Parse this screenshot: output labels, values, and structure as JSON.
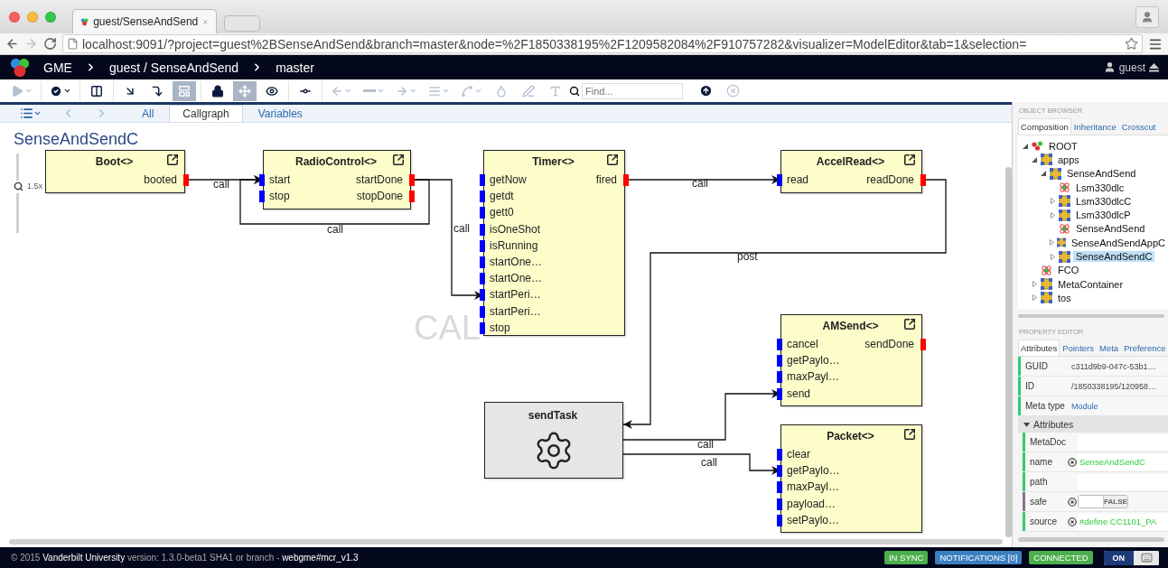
{
  "browser": {
    "tab_title": "guest/SenseAndSend",
    "url": "localhost:9091/?project=guest%2BSenseAndSend&branch=master&node=%2F1850338195%2F1209582084%2F910757282&visualizer=ModelEditor&tab=1&selection=",
    "nav": [
      {
        "kind": "back",
        "disabled": false
      },
      {
        "kind": "forward",
        "disabled": true
      },
      {
        "kind": "reload",
        "disabled": false
      }
    ]
  },
  "header": {
    "app": "GME",
    "project": "guest / SenseAndSend",
    "branch": "master",
    "user": "guest"
  },
  "toolbar": {
    "buttons": [
      {
        "kind": "play",
        "pressed": false,
        "disabled": true,
        "dropdown": true
      },
      {
        "kind": "check",
        "pressed": false,
        "disabled": false,
        "dropdown": true
      },
      {
        "kind": "split",
        "pressed": false,
        "disabled": false,
        "dropdown": false
      },
      {
        "kind": "arrow",
        "pressed": false,
        "disabled": false,
        "dropdown": false
      },
      {
        "kind": "elbow",
        "pressed": false,
        "disabled": false,
        "dropdown": false
      },
      {
        "kind": "grid",
        "pressed": true,
        "disabled": false,
        "dropdown": false
      },
      {
        "kind": "lock",
        "pressed": false,
        "disabled": false,
        "dropdown": false
      },
      {
        "kind": "move",
        "pressed": true,
        "disabled": false,
        "dropdown": false
      },
      {
        "kind": "eye",
        "pressed": false,
        "disabled": false,
        "dropdown": false
      },
      {
        "kind": "connector",
        "pressed": false,
        "disabled": false,
        "dropdown": false
      },
      {
        "kind": "left",
        "pressed": false,
        "disabled": true,
        "dropdown": true
      },
      {
        "kind": "line",
        "pressed": false,
        "disabled": true,
        "dropdown": true
      },
      {
        "kind": "right",
        "pressed": false,
        "disabled": true,
        "dropdown": true
      },
      {
        "kind": "lines",
        "pressed": false,
        "disabled": true,
        "dropdown": true
      },
      {
        "kind": "curve",
        "pressed": false,
        "disabled": true,
        "dropdown": true
      },
      {
        "kind": "fill",
        "pressed": false,
        "disabled": true,
        "dropdown": false
      },
      {
        "kind": "pen",
        "pressed": false,
        "disabled": true,
        "dropdown": false
      },
      {
        "kind": "text",
        "pressed": false,
        "disabled": true,
        "dropdown": false
      }
    ],
    "search": {
      "placeholder": "Find..."
    },
    "actions": [
      {
        "kind": "upload",
        "disabled": false
      },
      {
        "kind": "clear",
        "disabled": true
      }
    ]
  },
  "editor_nav": [
    {
      "kind": "list",
      "disabled": false
    },
    {
      "kind": "back",
      "disabled": true
    },
    {
      "kind": "forward",
      "disabled": true
    }
  ],
  "editor_tabs": [
    {
      "label": "All",
      "selected": false
    },
    {
      "label": "Callgraph",
      "selected": true
    },
    {
      "label": "Variables",
      "selected": false
    }
  ],
  "canvas": {
    "title": "SenseAndSendC",
    "watermark": "CAL",
    "zoom": {
      "label": "1.5x",
      "level": 0.58
    },
    "nodes": [
      {
        "kind": "module",
        "name": "Boot<>",
        "outputs": [
          "booted"
        ]
      },
      {
        "kind": "module",
        "name": "RadioControl<>",
        "inputs": [
          "start",
          "stop"
        ],
        "outputs": [
          "startDone",
          "stopDone"
        ]
      },
      {
        "kind": "module",
        "name": "Timer<>",
        "inputs": [
          "getNow",
          "getdt",
          "gett0",
          "isOneShot",
          "isRunning",
          "startOne…",
          "startOne…",
          "startPeri…",
          "startPeri…",
          "stop"
        ],
        "outputs": [
          "fired"
        ]
      },
      {
        "kind": "module",
        "name": "AccelRead<>",
        "inputs": [
          "read"
        ],
        "outputs": [
          "readDone"
        ]
      },
      {
        "kind": "module",
        "name": "AMSend<>",
        "inputs": [
          "cancel",
          "getPaylo…",
          "maxPayl…",
          "send"
        ],
        "outputs": [
          "sendDone"
        ]
      },
      {
        "kind": "module",
        "name": "Packet<>",
        "inputs": [
          "clear",
          "getPaylo…",
          "maxPayl…",
          "payload…",
          "setPaylo…"
        ]
      },
      {
        "kind": "task",
        "name": "sendTask"
      }
    ],
    "connections": [
      {
        "label": "call"
      },
      {
        "label": "call"
      },
      {
        "label": "call"
      },
      {
        "label": "call"
      },
      {
        "label": "post"
      },
      {
        "label": "call"
      },
      {
        "label": "call"
      }
    ]
  },
  "object_browser": {
    "title": "OBJECT BROWSER",
    "tabs": [
      {
        "label": "Composition",
        "selected": true
      },
      {
        "label": "Inheritance",
        "selected": false
      },
      {
        "label": "Crosscut",
        "selected": false
      }
    ],
    "tree": [
      {
        "label": "ROOT",
        "kind": "root",
        "expanded": true,
        "selected": false,
        "children": [
          {
            "label": "apps",
            "kind": "model",
            "expanded": true,
            "selected": false,
            "children": [
              {
                "label": "SenseAndSend",
                "kind": "model",
                "expanded": true,
                "selected": false,
                "children": [
                  {
                    "label": "Lsm330dlc",
                    "kind": "atom",
                    "selected": false
                  },
                  {
                    "label": "Lsm330dlcC",
                    "kind": "model",
                    "expanded": false,
                    "selected": false
                  },
                  {
                    "label": "Lsm330dlcP",
                    "kind": "model",
                    "expanded": false,
                    "selected": false
                  },
                  {
                    "label": "SenseAndSend",
                    "kind": "atom",
                    "selected": false
                  },
                  {
                    "label": "SenseAndSendAppC",
                    "kind": "model",
                    "expanded": false,
                    "selected": false
                  },
                  {
                    "label": "SenseAndSendC",
                    "kind": "model",
                    "expanded": false,
                    "selected": true
                  }
                ]
              }
            ]
          },
          {
            "label": "FCO",
            "kind": "atom",
            "selected": false
          },
          {
            "label": "MetaContainer",
            "kind": "model",
            "expanded": false,
            "selected": false
          },
          {
            "label": "tos",
            "kind": "model",
            "expanded": false,
            "selected": false
          }
        ]
      }
    ]
  },
  "property_editor": {
    "title": "PROPERTY EDITOR",
    "tabs": [
      {
        "label": "Attributes",
        "selected": true
      },
      {
        "label": "Pointers",
        "selected": false
      },
      {
        "label": "Meta",
        "selected": false
      },
      {
        "label": "Preference",
        "selected": false
      }
    ],
    "rows": [
      {
        "name": "GUID",
        "kind": "text",
        "value": "c311d9b9-047c-53b1…",
        "color": "#2ecc71"
      },
      {
        "name": "ID",
        "kind": "text",
        "value": "/1850338195/120958…",
        "color": "#2ecc71"
      },
      {
        "name": "Meta type",
        "kind": "link",
        "value": "Module",
        "color": "#2ecc71"
      }
    ],
    "group": {
      "label": "Attributes",
      "expanded": true,
      "rows": [
        {
          "name": "MetaDoc",
          "kind": "field",
          "resettable": false,
          "color": "#2ecc71"
        },
        {
          "name": "name",
          "kind": "field",
          "value": "SenseAndSendC",
          "resettable": true,
          "color": "#2ecc71"
        },
        {
          "name": "path",
          "kind": "field",
          "resettable": false,
          "color": "#2ecc71"
        },
        {
          "name": "safe",
          "kind": "toggle",
          "on": false,
          "value": "FALSE",
          "resettable": true,
          "color": "#8e6f93"
        },
        {
          "name": "source",
          "kind": "field",
          "value": "#define CC1101_PA",
          "resettable": true,
          "color": "#2ecc71"
        }
      ]
    }
  },
  "status_bar": {
    "text": "© 2015 **Vanderbilt University** version: 1.3.0-beta1 SHA1 or branch - **webgme#mcr_v1.3**",
    "badges": [
      {
        "label": "IN SYNC",
        "color": "#4cae4c"
      },
      {
        "label": "NOTIFICATIONS [0]",
        "color": "#3c7fc0"
      },
      {
        "label": "CONNECTED",
        "color": "#4cae4c"
      }
    ],
    "toggle": {
      "label": "ON",
      "on": true
    }
  }
}
